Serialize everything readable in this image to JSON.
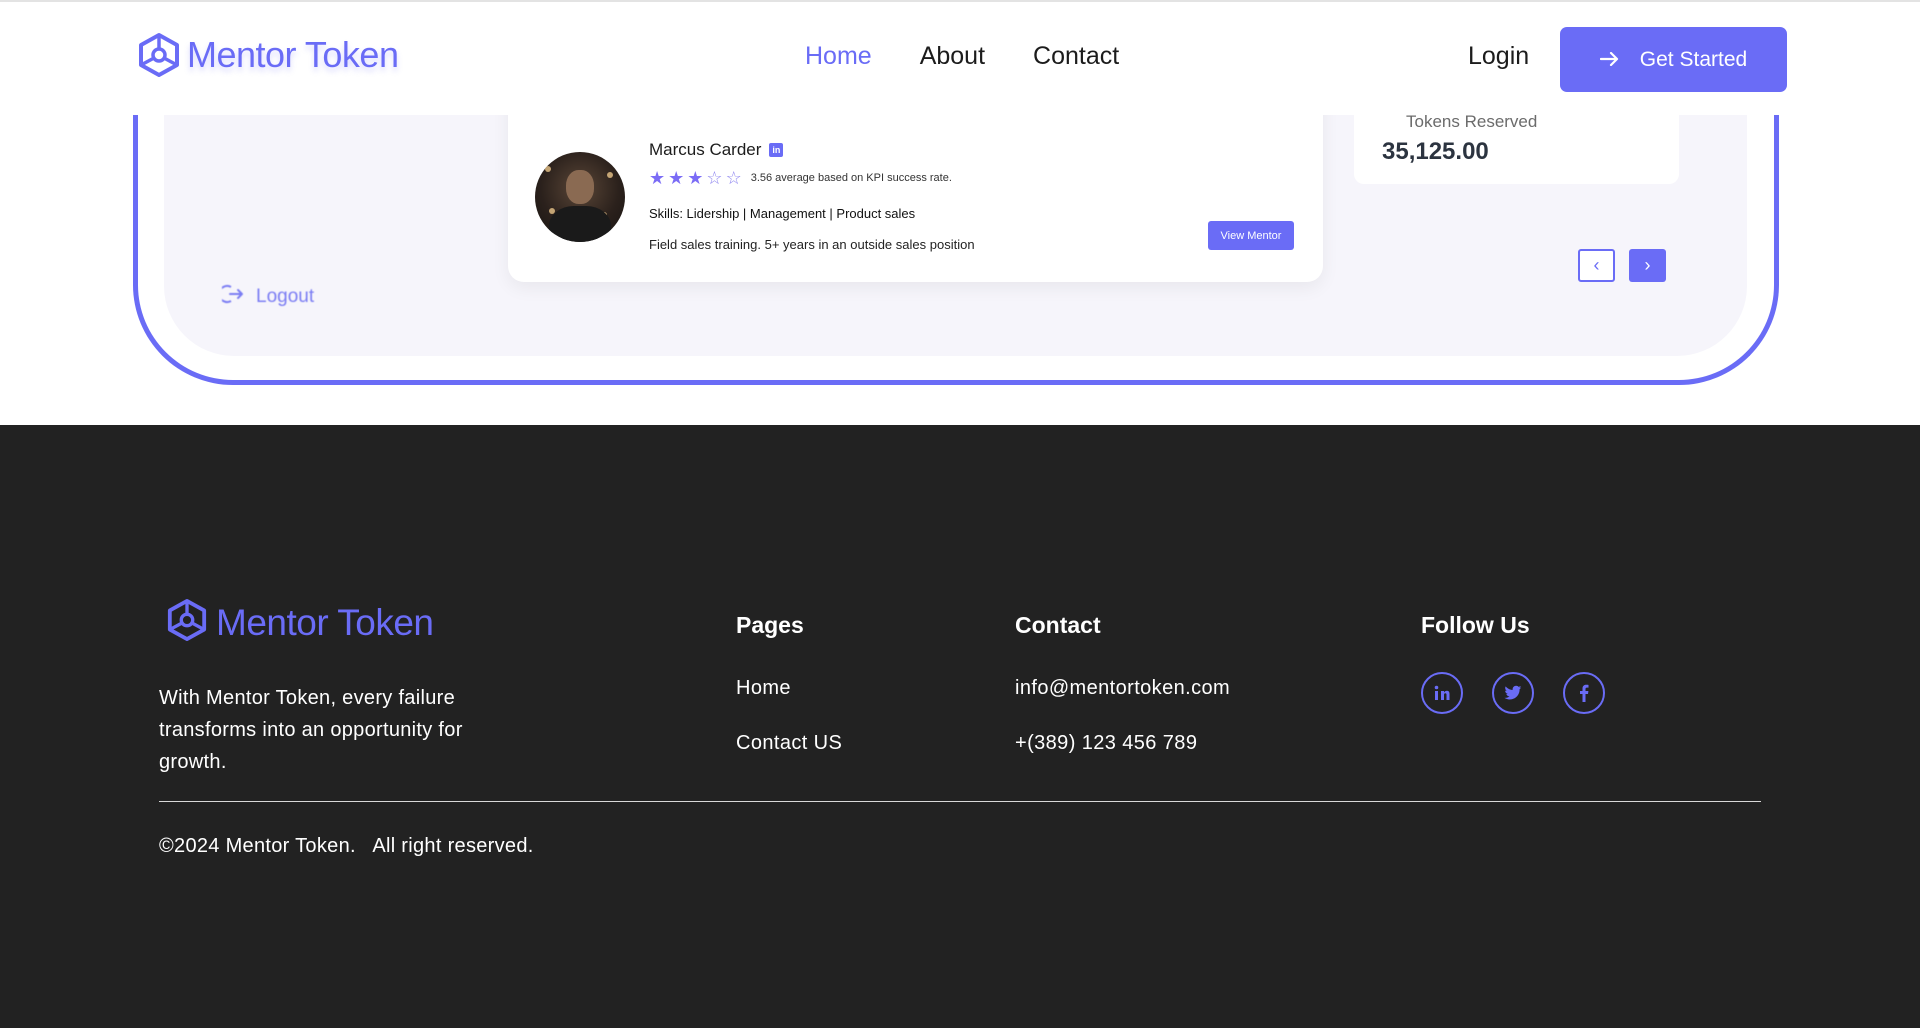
{
  "brand": {
    "name": "Mentor Token",
    "accent_color": "#6a6cf6",
    "logo_icon": "hexagon-logo-icon"
  },
  "nav": {
    "items": [
      {
        "label": "Home",
        "active": true
      },
      {
        "label": "About",
        "active": false
      },
      {
        "label": "Contact",
        "active": false
      }
    ],
    "login_label": "Login",
    "cta_label": "Get Started",
    "cta_icon": "arrow-right-icon"
  },
  "dashboard_preview": {
    "logout_label": "Logout",
    "mentor": {
      "name": "Marcus Carder",
      "rating_stars": 3,
      "rating_max": 5,
      "rating_text": "3.56 average based on KPI success rate.",
      "skills": "Skills: Lidership | Management | Product sales",
      "description": "Field sales training. 5+ years in an outside sales position",
      "view_button": "View Mentor"
    },
    "tokens": {
      "label": "Tokens Reserved",
      "value": "35,125.00"
    },
    "pager": {
      "prev": "‹",
      "next": "›"
    }
  },
  "footer": {
    "brand_name": "Mentor Token",
    "tagline": "With Mentor Token, every failure transforms into an opportunity for growth.",
    "pages": {
      "title": "Pages",
      "links": [
        "Home",
        "Contact US"
      ]
    },
    "contact": {
      "title": "Contact",
      "email": "info@mentortoken.com",
      "phone": "+(389) 123 456 789"
    },
    "follow": {
      "title": "Follow Us",
      "icons": [
        "linkedin-icon",
        "twitter-icon",
        "facebook-icon"
      ]
    },
    "copyright": "©2024 Mentor Token.   All right reserved."
  }
}
